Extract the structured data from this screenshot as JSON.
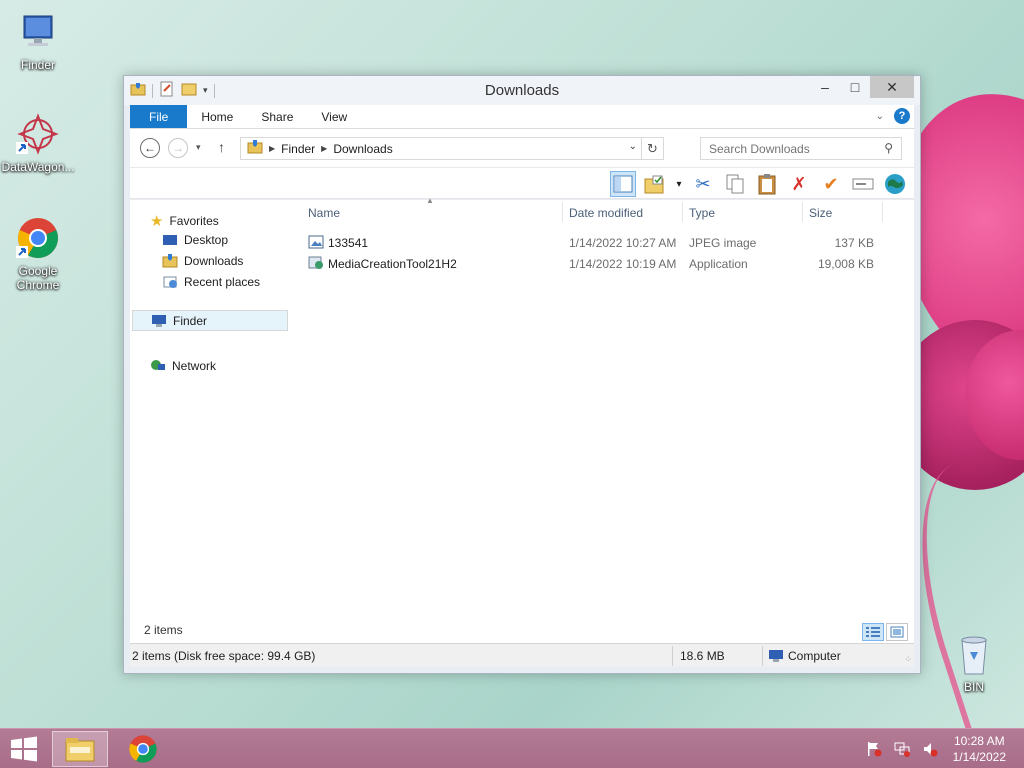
{
  "desktop": {
    "icons": [
      {
        "label": "Finder"
      },
      {
        "label": "DataWagon..."
      },
      {
        "label": "Google Chrome"
      },
      {
        "label": "BIN"
      }
    ]
  },
  "window": {
    "title": "Downloads",
    "tabs": {
      "file": "File",
      "home": "Home",
      "share": "Share",
      "view": "View"
    },
    "address": {
      "root": "Finder",
      "current": "Downloads"
    },
    "search": {
      "placeholder": "Search Downloads"
    },
    "nav": {
      "favorites": "Favorites",
      "desktop": "Desktop",
      "downloads": "Downloads",
      "recent": "Recent places",
      "finder": "Finder",
      "network": "Network"
    },
    "columns": {
      "name": "Name",
      "date": "Date modified",
      "type": "Type",
      "size": "Size"
    },
    "files": [
      {
        "name": "133541",
        "date": "1/14/2022 10:27 AM",
        "type": "JPEG image",
        "size": "137 KB"
      },
      {
        "name": "MediaCreationTool21H2",
        "date": "1/14/2022 10:19 AM",
        "type": "Application",
        "size": "19,008 KB"
      }
    ],
    "item_count": "2 items",
    "status": {
      "left": "2 items (Disk free space: 99.4 GB)",
      "size": "18.6 MB",
      "location": "Computer"
    }
  },
  "taskbar": {
    "time": "10:28 AM",
    "date": "1/14/2022"
  },
  "colors": {
    "accent": "#1979ca",
    "taskbar": "#a86d89"
  }
}
